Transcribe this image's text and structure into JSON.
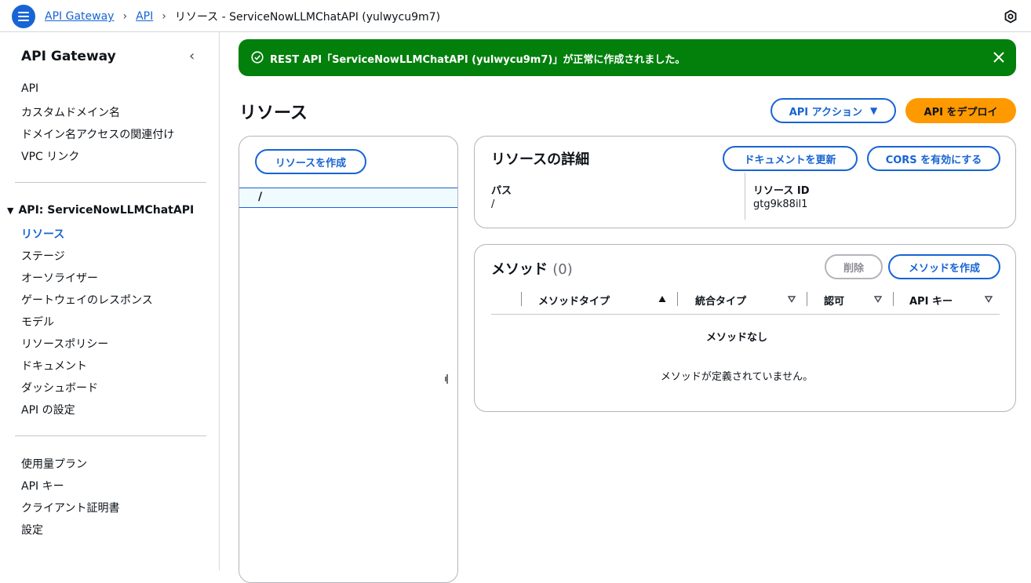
{
  "breadcrumb": {
    "items": [
      "API Gateway",
      "API"
    ],
    "current": "リソース - ServiceNowLLMChatAPI (yulwycu9m7)"
  },
  "sidebar": {
    "title": "API Gateway",
    "top_items": [
      "API",
      "カスタムドメイン名",
      "ドメイン名アクセスの関連付け",
      "VPC リンク"
    ],
    "api_section_title": "API: ServiceNowLLMChatAPI",
    "api_items": [
      "リソース",
      "ステージ",
      "オーソライザー",
      "ゲートウェイのレスポンス",
      "モデル",
      "リソースポリシー",
      "ドキュメント",
      "ダッシュボード",
      "API の設定"
    ],
    "active_item": "リソース",
    "bottom_items": [
      "使用量プラン",
      "API キー",
      "クライアント証明書",
      "設定"
    ]
  },
  "flash": {
    "message": "REST API「ServiceNowLLMChatAPI (yulwycu9m7)」が正常に作成されました。",
    "color": "#037f0c"
  },
  "page": {
    "title": "リソース",
    "api_actions_label": "API アクション",
    "deploy_label": "API をデプロイ"
  },
  "tree": {
    "create_resource_label": "リソースを作成",
    "selected_path": "/"
  },
  "details": {
    "title": "リソースの詳細",
    "update_docs_label": "ドキュメントを更新",
    "enable_cors_label": "CORS を有効にする",
    "path_label": "パス",
    "path_value": "/",
    "resource_id_label": "リソース ID",
    "resource_id_value": "gtg9k88il1"
  },
  "methods": {
    "title": "メソッド",
    "count": "(0)",
    "delete_label": "削除",
    "create_label": "メソッドを作成",
    "columns": [
      "メソッドタイプ",
      "統合タイプ",
      "認可",
      "API キー"
    ],
    "empty_title": "メソッドなし",
    "empty_desc": "メソッドが定義されていません。"
  },
  "colors": {
    "accent": "#1764d4",
    "primary_button": "#ff9900"
  }
}
